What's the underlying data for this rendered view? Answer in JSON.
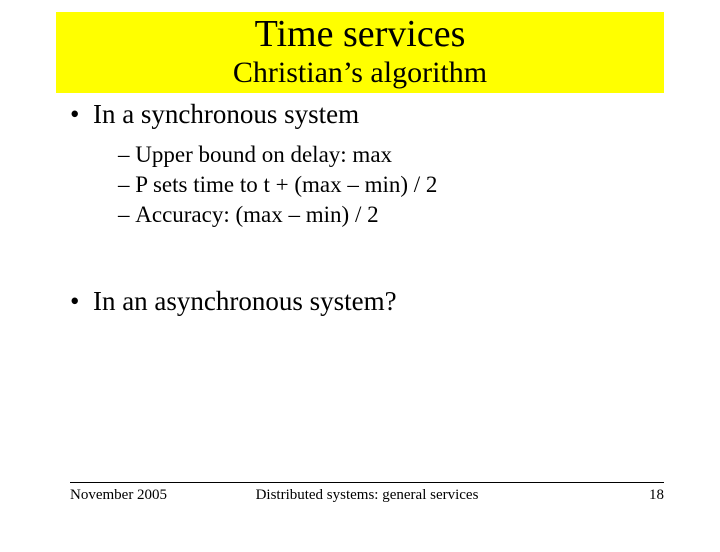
{
  "header": {
    "title": "Time services",
    "subtitle": "Christian’s algorithm"
  },
  "content": {
    "bullet1": "In a synchronous system",
    "sub": [
      "Upper bound on delay:  max",
      "P sets time to t + (max – min) / 2",
      "Accuracy: (max – min) / 2"
    ],
    "bullet2": "In an asynchronous system?"
  },
  "footer": {
    "date": "November 2005",
    "center": "Distributed systems: general services",
    "page": "18"
  }
}
